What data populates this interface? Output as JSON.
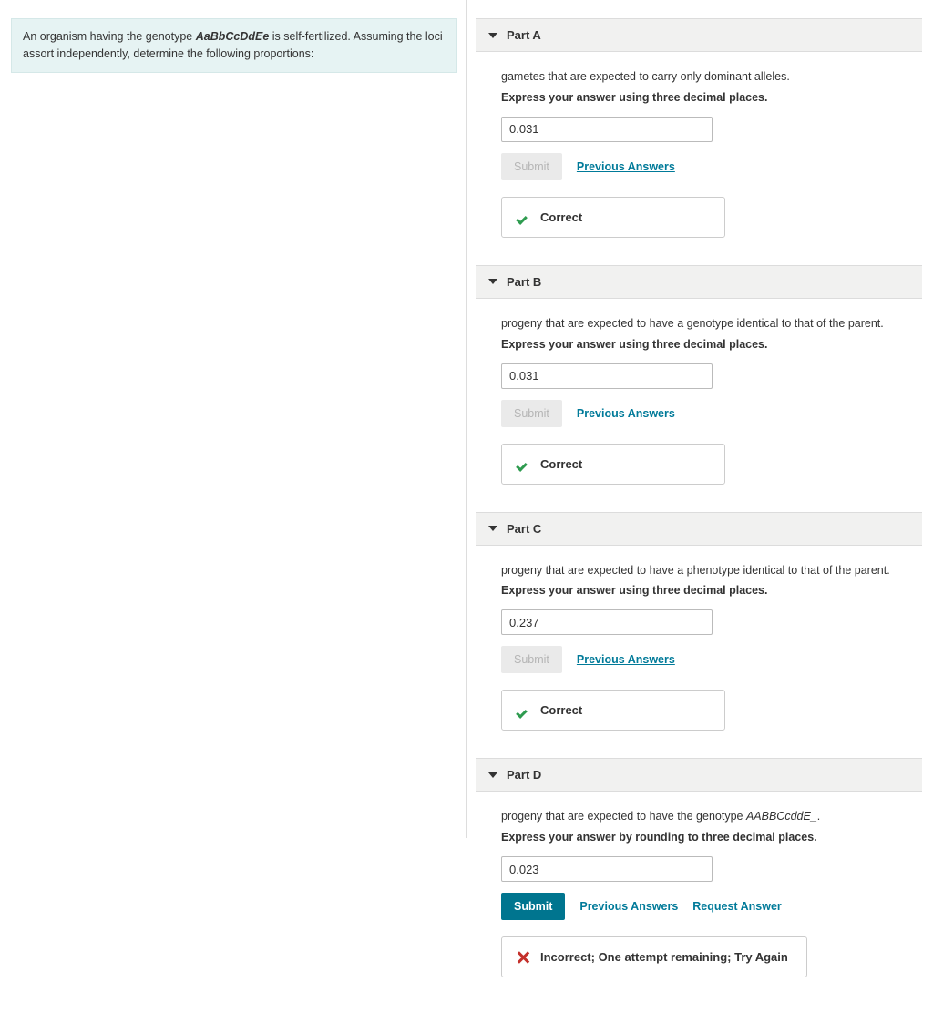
{
  "prompt": {
    "pre": "An organism having the genotype ",
    "genotype": "AaBbCcDdEe",
    "post": " is self-fertilized. Assuming the loci assort independently, determine the following proportions:"
  },
  "common": {
    "submit": "Submit",
    "prev": "Previous Answers",
    "request": "Request Answer",
    "correct": "Correct"
  },
  "parts": {
    "A": {
      "title": "Part A",
      "q": "gametes that are expected to carry only dominant alleles.",
      "instr": "Express your answer using three decimal places.",
      "value": "0.031",
      "submit_active": false,
      "prev_underline": true,
      "feedback": "Correct",
      "status": "correct"
    },
    "B": {
      "title": "Part B",
      "q": "progeny that are expected to have a genotype identical to that of the parent.",
      "instr": "Express your answer using three decimal places.",
      "value": "0.031",
      "submit_active": false,
      "prev_underline": false,
      "feedback": "Correct",
      "status": "correct"
    },
    "C": {
      "title": "Part C",
      "q": "progeny that are expected to have a phenotype identical to that of the parent.",
      "instr": "Express your answer using three decimal places.",
      "value": "0.237",
      "submit_active": false,
      "prev_underline": true,
      "feedback": "Correct",
      "status": "correct"
    },
    "D": {
      "title": "Part D",
      "q_pre": "progeny that are expected to have the genotype ",
      "q_geno": "AABBCcddE_",
      "q_post": ".",
      "instr": "Express your answer by rounding to three decimal places.",
      "value": "0.023",
      "submit_active": true,
      "prev_underline": false,
      "feedback": "Incorrect; One attempt remaining; Try Again",
      "status": "incorrect"
    }
  }
}
